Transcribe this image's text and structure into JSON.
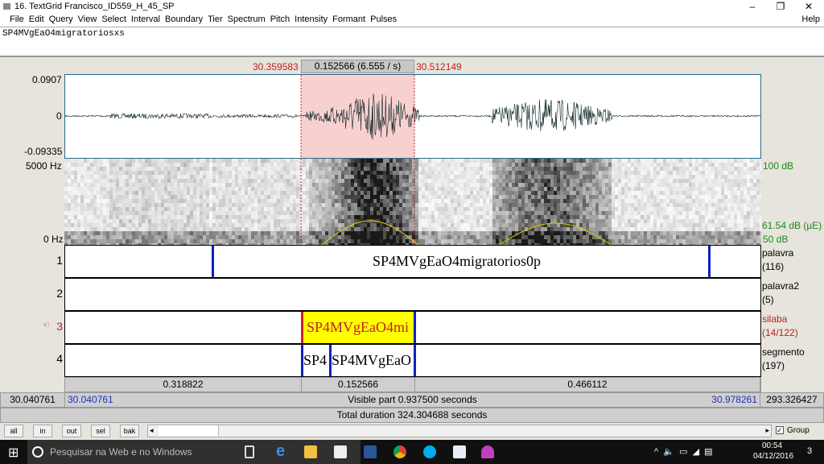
{
  "window": {
    "title": "16. TextGrid Francisco_ID559_H_45_SP",
    "controls": [
      "–",
      "❐",
      "✕"
    ]
  },
  "menu": [
    "File",
    "Edit",
    "Query",
    "View",
    "Select",
    "Interval",
    "Boundary",
    "Tier",
    "Spectrum",
    "Pitch",
    "Intensity",
    "Formant",
    "Pulses"
  ],
  "help": "Help",
  "text_field": "SP4MVgEaO4migratoriosxs",
  "selection": {
    "start": "30.359583",
    "end": "30.512149",
    "duration": "0.152566 (6.555 / s)"
  },
  "waveform": {
    "max": "0.0907",
    "zero": "0",
    "min": "-0.09335"
  },
  "spectrogram": {
    "top": "5000 Hz",
    "bottom": "0 Hz",
    "intensity_top": "100 dB",
    "intensity_value": "61.54 dB (µE)",
    "intensity_bottom": "50 dB",
    "pitch_color": "#e0d000"
  },
  "tiers": [
    {
      "num": "1",
      "name": "palavra",
      "count": "(116)",
      "intervals": [
        "SP4MVgEaO4migratorios0p"
      ]
    },
    {
      "num": "2",
      "name": "palavra2",
      "count": "(5)",
      "intervals": []
    },
    {
      "num": "3",
      "name": "silaba",
      "count": "(14/122)",
      "intervals": [
        "SP4MVgEaO4mi"
      ],
      "selected": true,
      "pointer": "☜"
    },
    {
      "num": "4",
      "name": "segmento",
      "count": "(197)",
      "intervals": [
        "SP4",
        "SP4MVgEaO"
      ]
    }
  ],
  "durations": [
    "0.318822",
    "0.152566",
    "0.466112"
  ],
  "visible": {
    "left_total": "30.040761",
    "left": "30.040761",
    "label": "Visible part 0.937500 seconds",
    "right": "30.978261",
    "right_total": "293.326427"
  },
  "total": "Total duration 324.304688 seconds",
  "buttons": [
    "all",
    "in",
    "out",
    "sel",
    "bak"
  ],
  "group": "Group",
  "taskbar": {
    "search": "Pesquisar na Web e no Windows",
    "time": "00:54",
    "date": "04/12/2016",
    "notif": "3"
  },
  "colors": {
    "selection": "#f8d0d0",
    "selected_interval": "#ffff00",
    "boundary": "#1020c0"
  }
}
